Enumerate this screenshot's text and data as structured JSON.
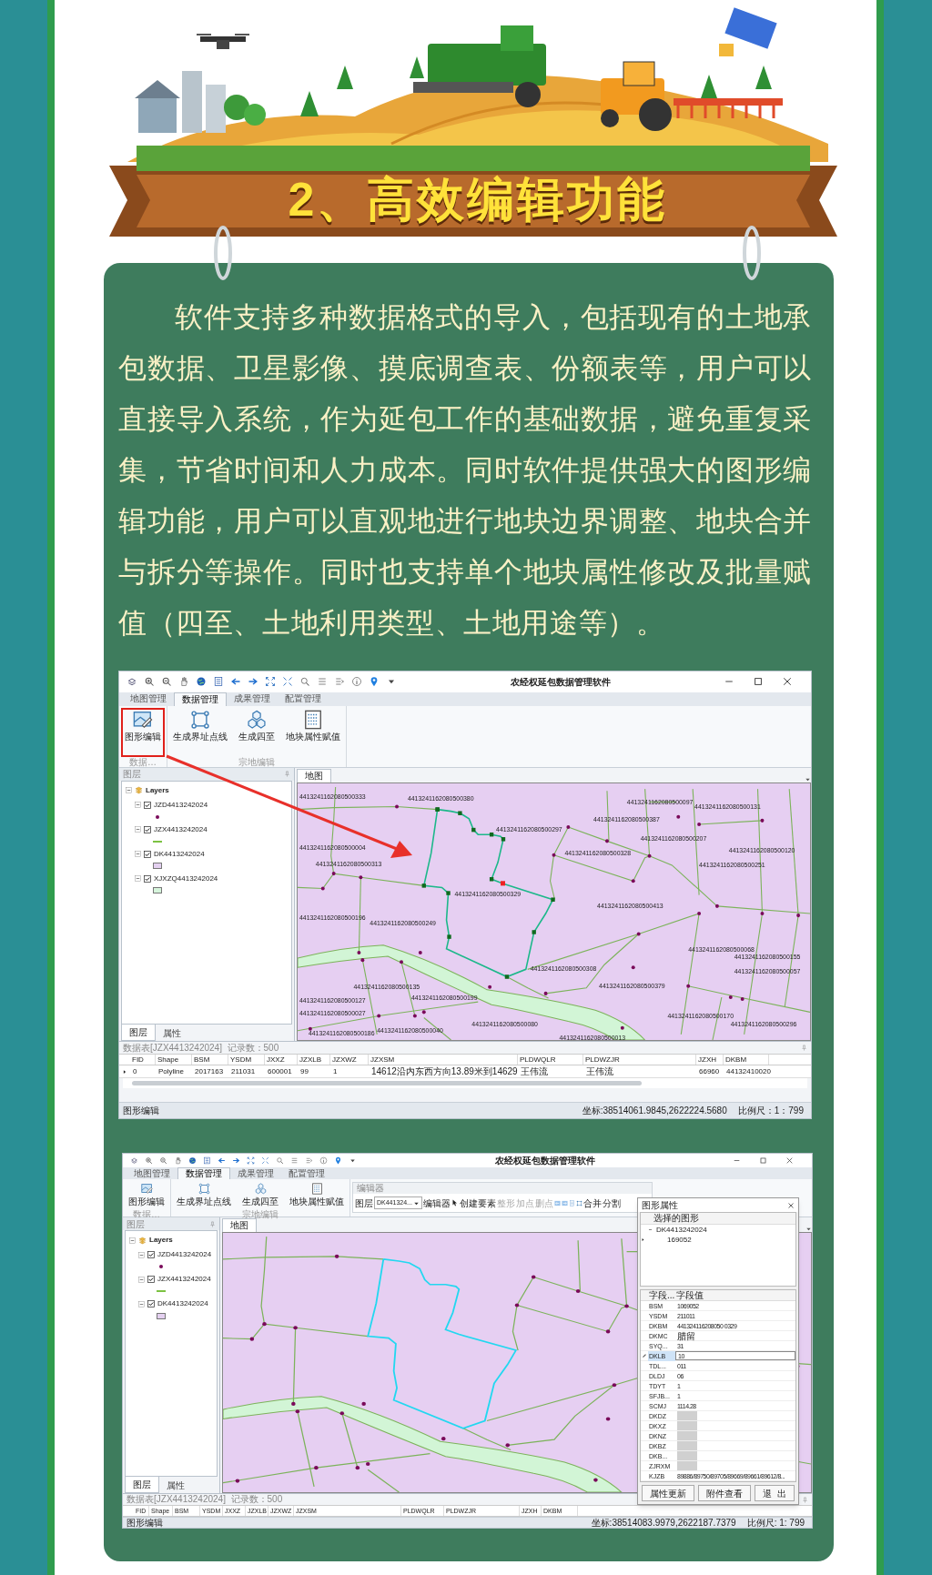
{
  "poster": {
    "title": "2、高效编辑功能",
    "paragraph": "软件支持多种数据格式的导入，包括现有的土地承包数据、卫星影像、摸底调查表、份额表等，用户可以直接导入系统，作为延包工作的基础数据，避免重复采集，节省时间和人力成本。同时软件提供强大的图形编辑功能，用户可以直观地进行地块边界调整、地块合并与拆分等操作。同时也支持单个地块属性修改及批量赋值（四至、土地利用类型、土地用途等）。"
  },
  "screenshots": [
    {
      "kind": "large",
      "title": "农经权延包数据管理软件",
      "tabs": [
        {
          "label": "地图管理",
          "selected": false
        },
        {
          "label": "数据管理",
          "selected": true
        },
        {
          "label": "成果管理",
          "selected": false
        },
        {
          "label": "配置管理",
          "selected": false
        }
      ],
      "ribbon": [
        {
          "label": "数据…",
          "buttons": [
            {
              "label": "图形编辑",
              "highlighted": true
            }
          ]
        },
        {
          "label": "宗地编辑",
          "buttons": [
            {
              "label": "生成界址点线",
              "highlighted": false
            },
            {
              "label": "生成四至",
              "highlighted": false
            },
            {
              "label": "地块属性赋值",
              "highlighted": false
            }
          ]
        }
      ],
      "layers_panel": {
        "title": "图层",
        "root": "Layers",
        "layers": [
          {
            "name": "JZD4413242024",
            "checked": true,
            "kind": "point",
            "color": "#7a0a5a"
          },
          {
            "name": "JZX4413242024",
            "checked": true,
            "kind": "line",
            "color": "#7cc242"
          },
          {
            "name": "DK4413242024",
            "checked": true,
            "kind": "fill",
            "color": "#e4d0f0"
          },
          {
            "name": "XJXZQ4413242024",
            "checked": true,
            "kind": "fill",
            "color": "#d6f5dc"
          }
        ],
        "tabs": [
          {
            "label": "图层",
            "selected": true
          },
          {
            "label": "属性",
            "selected": false
          }
        ]
      },
      "map": {
        "tab": "地图",
        "edit_mode": true,
        "labels": [
          "4413241162080500333",
          "4413241162080500004",
          "4413241162080500380",
          "4413241162080500313",
          "4413241162080500097",
          "4413241162080500131",
          "4413241162080500387",
          "4413241162080500297",
          "4413241162080500207",
          "4413241162080500328",
          "4413241162080500120",
          "4413241162080500251",
          "4413241162080500329",
          "4413241162080500413",
          "4413241162080500196",
          "4413241162080500249",
          "4413241162080500068",
          "4413241162080500155",
          "4413241162080500308",
          "4413241162080500057",
          "4413241162080500135",
          "4413241162080500379",
          "4413241162080500127",
          "4413241162080500199",
          "4413241162080500027",
          "4413241162080500170",
          "4413241162080500080",
          "4413241162080500296",
          "4413241162080500186",
          "4413241162080500040",
          "4413241162080500013"
        ]
      },
      "table": {
        "title": "数据表[JZX4413242024]  记录数：500",
        "columns": [
          "FID",
          "Shape",
          "BSM",
          "YSDM",
          "JXXZ",
          "JZXLB",
          "JZXWZ",
          "JZXSM",
          "PLDWQLR",
          "PLDWZJR",
          "JZXH",
          "DKBM"
        ],
        "rows": [
          {
            "selected": true,
            "cells": [
              "0",
              "Polyline",
              "2017163",
              "211031",
              "600001",
              "99",
              "1",
              "14612沿内东西方向13.89米到14629",
              "王伟流",
              "王伟流",
              "66960",
              "44132410020"
            ]
          }
        ]
      },
      "status": {
        "mode": "图形编辑",
        "coords": "坐标:38514061.9845,2622224.5680",
        "scale": "比例尺：1：799"
      }
    },
    {
      "kind": "small",
      "title": "农经权延包数据管理软件",
      "tabs": [
        {
          "label": "地图管理",
          "selected": false
        },
        {
          "label": "数据管理",
          "selected": true
        },
        {
          "label": "成果管理",
          "selected": false
        },
        {
          "label": "配置管理",
          "selected": false
        }
      ],
      "ribbon": [
        {
          "label": "数据…",
          "buttons": [
            {
              "label": "图形编辑",
              "highlighted": false
            }
          ]
        },
        {
          "label": "宗地编辑",
          "buttons": [
            {
              "label": "生成界址点线",
              "highlighted": false
            },
            {
              "label": "生成四至",
              "highlighted": false
            },
            {
              "label": "地块属性赋值",
              "highlighted": false
            }
          ]
        }
      ],
      "editor_toolbar": {
        "title": "编辑器",
        "layer_label": "图层",
        "layer_value": "DK441324...",
        "menu": "编辑器",
        "tools": [
          {
            "label": "创建要素",
            "disabled": false
          },
          {
            "label": "整形",
            "disabled": true
          },
          {
            "label": "加点",
            "disabled": true
          },
          {
            "label": "删点",
            "disabled": true
          },
          {
            "label": "合并",
            "disabled": false
          },
          {
            "label": "分割",
            "disabled": false
          }
        ]
      },
      "layers_panel": {
        "title": "图层",
        "root": "Layers",
        "layers": [
          {
            "name": "JZD4413242024",
            "checked": true,
            "kind": "point",
            "color": "#7a0a5a"
          },
          {
            "name": "JZX4413242024",
            "checked": true,
            "kind": "line",
            "color": "#7cc242"
          },
          {
            "name": "DK4413242024",
            "checked": true,
            "kind": "fill",
            "color": "#e4d0f0"
          }
        ],
        "tabs": [
          {
            "label": "图层",
            "selected": true
          },
          {
            "label": "属性",
            "selected": false
          }
        ]
      },
      "map": {
        "tab": "地图",
        "edit_mode": false
      },
      "table": {
        "title": "数据表[JZX4413242024]  记录数：500",
        "columns": [
          "FID",
          "Shape",
          "BSM",
          "YSDM",
          "JXXZ",
          "JZXLB",
          "JZXWZ",
          "JZXSM",
          "PLDWQLR",
          "PLDWZJR",
          "JZXH",
          "DKBM"
        ]
      },
      "dialog": {
        "title": "图形属性",
        "tree_header": "选择的图形",
        "tree_root": "DK4413242024",
        "tree_child": "169052",
        "grid_columns": [
          "字段...",
          "字段值"
        ],
        "fields": [
          {
            "name": "BSM",
            "value": "1069052",
            "selected": false
          },
          {
            "name": "YSDM",
            "value": "211011",
            "selected": false
          },
          {
            "name": "DKBM",
            "value": "441324116208050 0329",
            "selected": false
          },
          {
            "name": "DKMC",
            "value": "腊留",
            "selected": false
          },
          {
            "name": "SYQ...",
            "value": "31",
            "selected": false
          },
          {
            "name": "DKLB",
            "value": "10",
            "selected": true
          },
          {
            "name": "TDL...",
            "value": "011",
            "selected": false
          },
          {
            "name": "DLDJ",
            "value": "06",
            "selected": false
          },
          {
            "name": "TDYT",
            "value": "1",
            "selected": false
          },
          {
            "name": "SFJB...",
            "value": "1",
            "selected": false
          },
          {
            "name": "SCMJ",
            "value": "1114.28",
            "selected": false
          },
          {
            "name": "DKDZ",
            "redacted": true,
            "selected": false
          },
          {
            "name": "DKXZ",
            "redacted": true,
            "selected": false
          },
          {
            "name": "DKNZ",
            "redacted": true,
            "selected": false
          },
          {
            "name": "DKBZ",
            "redacted": true,
            "selected": false
          },
          {
            "name": "DKB...",
            "redacted": true,
            "selected": false
          },
          {
            "name": "ZJRXM",
            "redacted": true,
            "selected": false
          },
          {
            "name": "KJZB",
            "value": "89886/89750/89705/89669/89661/89612/8...",
            "selected": false
          }
        ],
        "buttons": [
          "属性更新",
          "附件查看",
          "退  出"
        ]
      },
      "status": {
        "mode": "图形编辑",
        "coords": "坐标:38514083.9979,2622187.7379",
        "scale": "比例尺: 1: 799"
      }
    }
  ]
}
